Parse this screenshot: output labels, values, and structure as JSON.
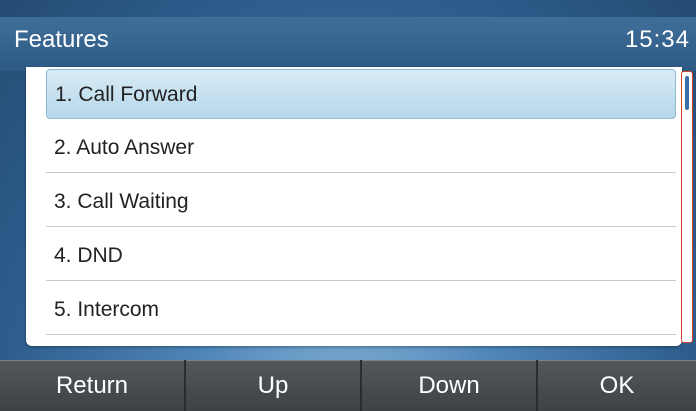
{
  "header": {
    "title": "Features",
    "time": "15:34"
  },
  "menu": {
    "items": [
      {
        "label": "1. Call Forward",
        "selected": true
      },
      {
        "label": "2. Auto Answer",
        "selected": false
      },
      {
        "label": "3. Call Waiting",
        "selected": false
      },
      {
        "label": "4. DND",
        "selected": false
      },
      {
        "label": "5. Intercom",
        "selected": false
      }
    ]
  },
  "softkeys": {
    "return": "Return",
    "up": "Up",
    "down": "Down",
    "ok": "OK"
  },
  "colors": {
    "selection": "#b5d7ea",
    "scrollbar_border": "#d8452c",
    "header_bg": "#2d5a84",
    "softkey_bg": "#3e4246"
  }
}
